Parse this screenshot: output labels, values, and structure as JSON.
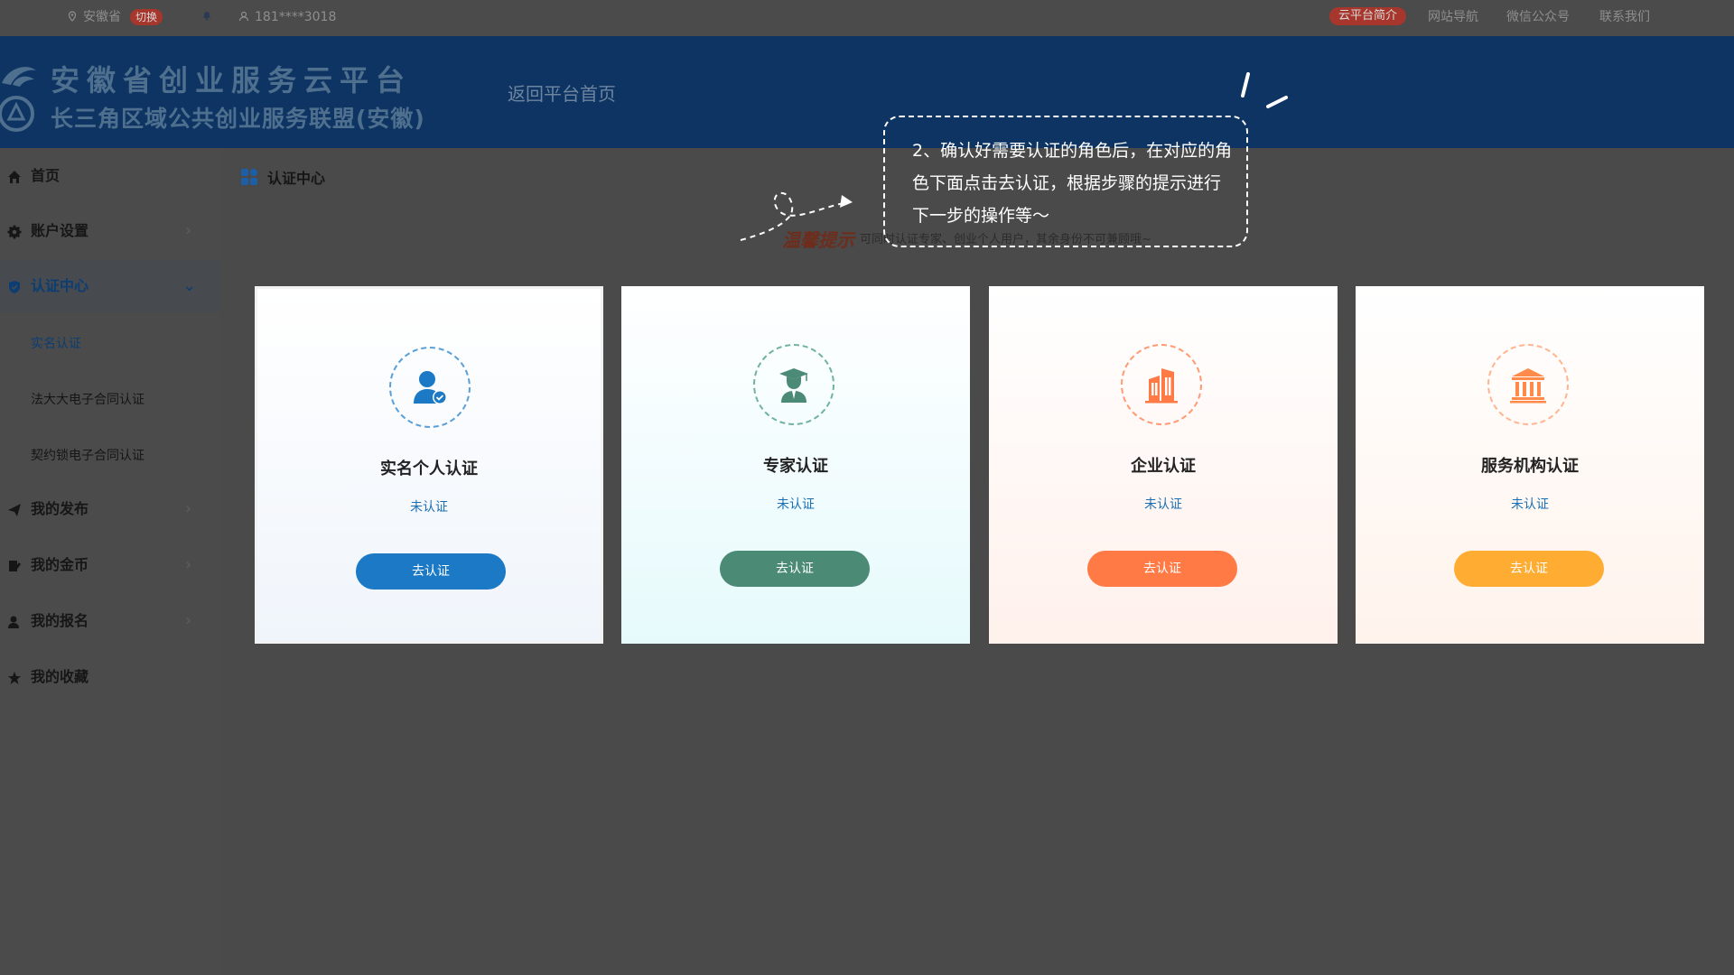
{
  "topbar": {
    "location": "安徽省",
    "switch_label": "切换",
    "phone": "181****3018",
    "platform_intro": "云平台简介",
    "site_nav": "网站导航",
    "wechat": "微信公众号",
    "contact": "联系我们"
  },
  "header": {
    "brand_line1": "安徽省创业服务云平台",
    "brand_line2": "长三角区域公共创业服务联盟(安徽)",
    "back_home": "返回平台首页"
  },
  "sidebar": {
    "items": [
      {
        "label": "首页",
        "icon": "home-icon"
      },
      {
        "label": "账户设置",
        "icon": "gear-icon"
      },
      {
        "label": "认证中心",
        "icon": "shield-icon",
        "expanded": true
      },
      {
        "label": "我的发布",
        "icon": "send-icon"
      },
      {
        "label": "我的金币",
        "icon": "coin-icon"
      },
      {
        "label": "我的报名",
        "icon": "user-icon"
      },
      {
        "label": "我的收藏",
        "icon": "star-icon"
      }
    ],
    "sub_items": [
      {
        "label": "实名认证",
        "active": true
      },
      {
        "label": "法大大电子合同认证"
      },
      {
        "label": "契约锁电子合同认证"
      }
    ]
  },
  "main": {
    "breadcrumb": "认证中心",
    "tip_title": "温馨提示",
    "tip_text": "可同时认证专家、创业个人用户，其余身份不可兼顾哦~",
    "cards": [
      {
        "name": "实名个人认证",
        "status": "未认证",
        "button": "去认证",
        "color": "#1b79c6",
        "icon": "person-verified-icon"
      },
      {
        "name": "专家认证",
        "status": "未认证",
        "button": "去认证",
        "color": "#4b8a74",
        "icon": "graduate-icon"
      },
      {
        "name": "企业认证",
        "status": "未认证",
        "button": "去认证",
        "color": "#ff7a45",
        "icon": "building-icon"
      },
      {
        "name": "服务机构认证",
        "status": "未认证",
        "button": "去认证",
        "color": "#ffac33",
        "icon": "institution-icon"
      }
    ]
  },
  "guide": {
    "text": "2、确认好需要认证的角色后，在对应的角色下面点击去认证，根据步骤的提示进行下一步的操作等～"
  }
}
